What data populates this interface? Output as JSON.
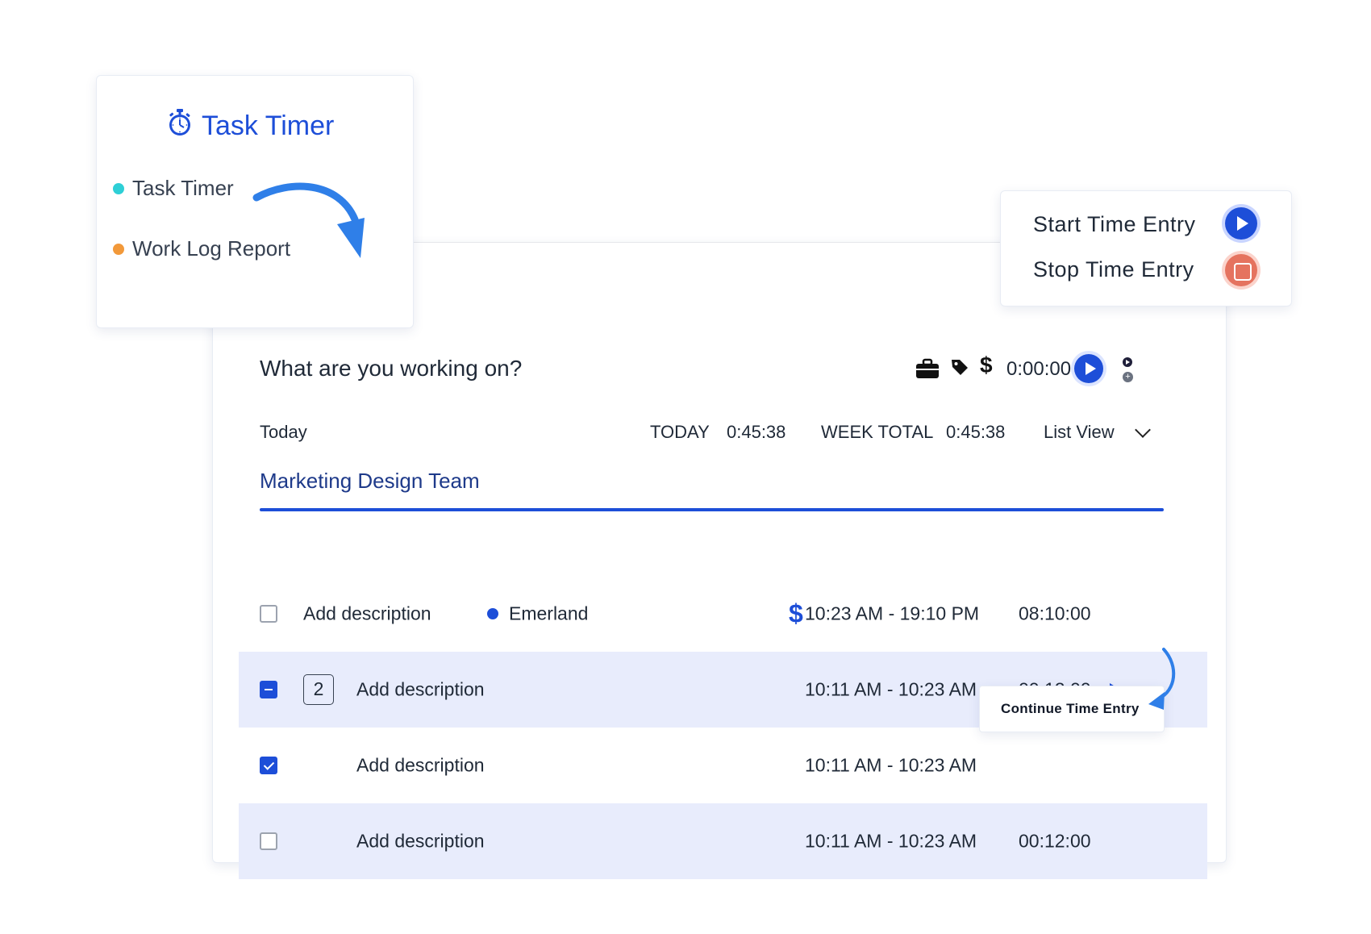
{
  "menu": {
    "title": "Task Timer",
    "items": [
      {
        "label": "Task Timer",
        "dot_color": "#2ecfd6"
      },
      {
        "label": "Work Log Report",
        "dot_color": "#f2993a"
      }
    ]
  },
  "legend": {
    "start_label": "Start Time Entry",
    "stop_label": "Stop Time Entry"
  },
  "timer": {
    "prompt": "What are you working on?",
    "dollar": "$",
    "time": "0:00:00",
    "plus": "+"
  },
  "summary": {
    "day_label": "Today",
    "today_label": "TODAY",
    "today_value": "0:45:38",
    "week_label": "WEEK TOTAL",
    "week_value": "0:45:38",
    "view_label": "List View"
  },
  "team": "Marketing Design Team",
  "entries": [
    {
      "description": "Add description",
      "project": "Emerland",
      "billable": "$",
      "range": "10:23 AM - 19:10 PM",
      "duration": "08:10:00",
      "checkbox": "unchecked"
    },
    {
      "badge": "2",
      "description": "Add description",
      "range": "10:11 AM - 10:23 AM",
      "duration": "00:12:00",
      "checkbox": "partial"
    },
    {
      "description": "Add description",
      "range": "10:11 AM - 10:23 AM",
      "checkbox": "checked"
    },
    {
      "description": "Add description",
      "range": "10:11 AM - 10:23 AM",
      "duration": "00:12:00",
      "checkbox": "unchecked"
    }
  ],
  "tooltip": "Continue Time Entry",
  "colors": {
    "accent": "#1d4ed8",
    "stop": "#e5735f",
    "row_highlight": "#e8ecfc",
    "arrow": "#2f7fe8"
  }
}
